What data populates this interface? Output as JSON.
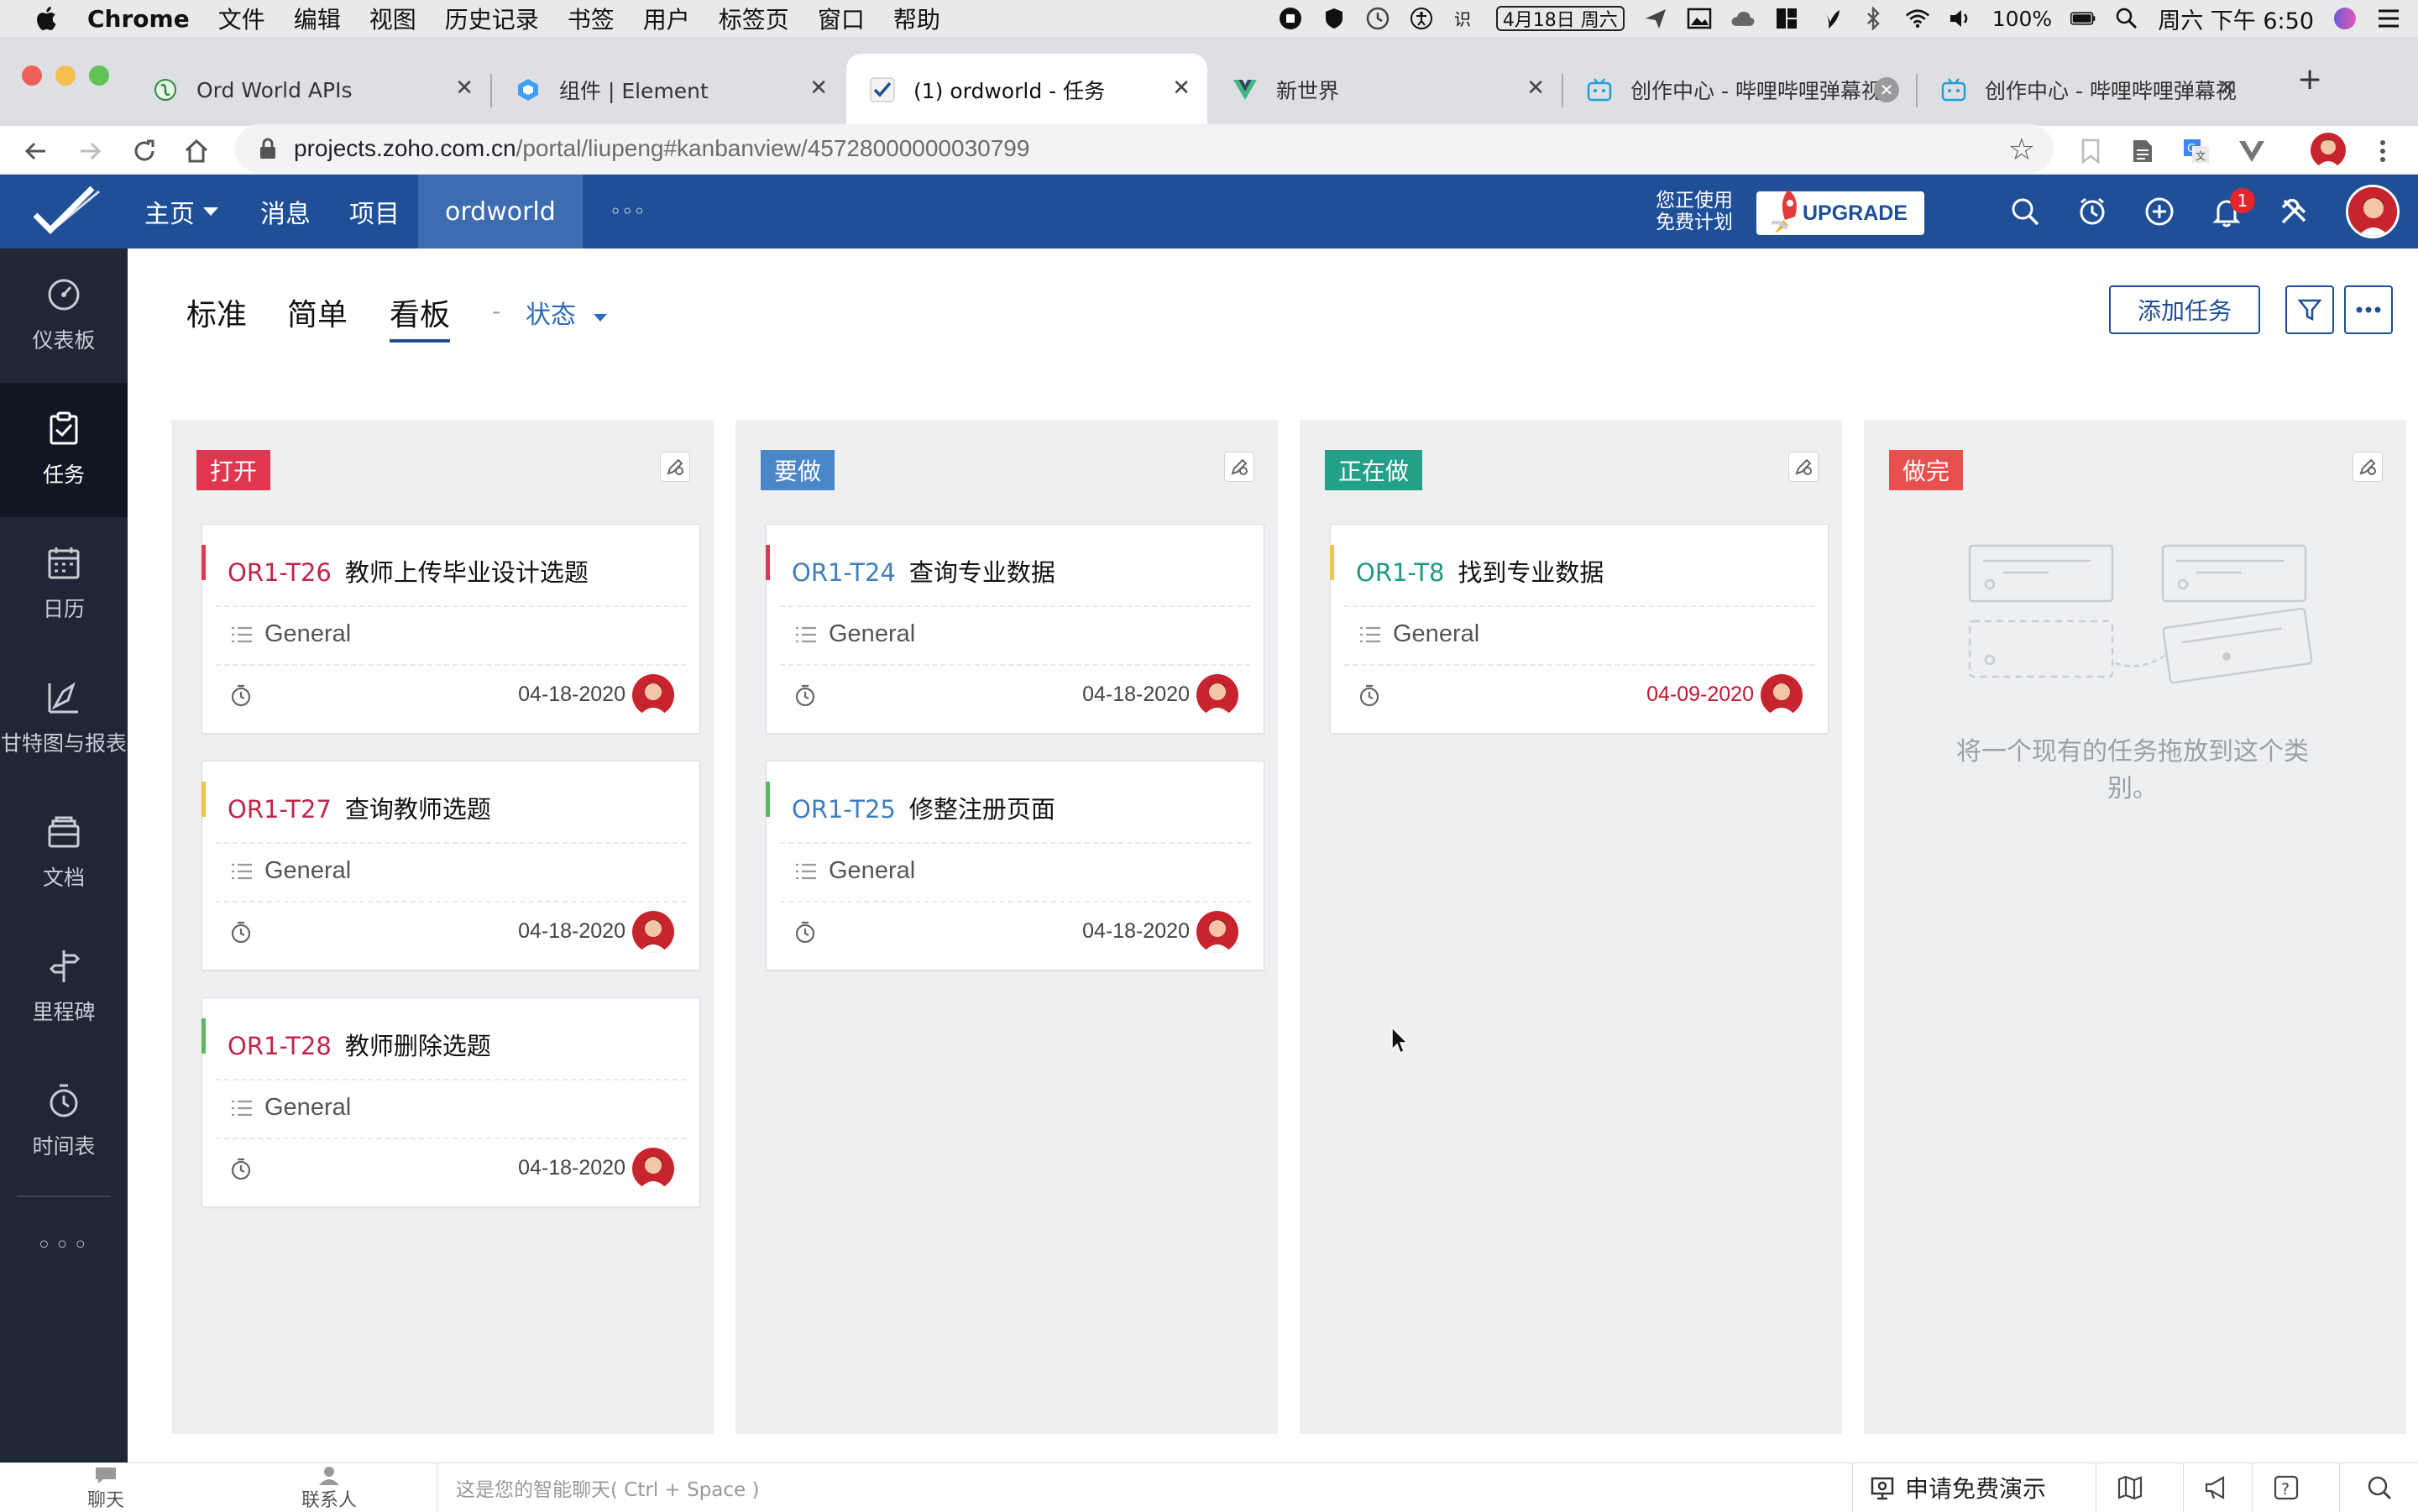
{
  "menubar": {
    "app_name": "Chrome",
    "items": [
      "文件",
      "编辑",
      "视图",
      "历史记录",
      "书签",
      "用户",
      "标签页",
      "窗口",
      "帮助"
    ],
    "date_badge": "4月18日 周六",
    "battery": "100%",
    "clock": "周六 下午 6:50"
  },
  "tabs": [
    {
      "title": "Ord World APIs"
    },
    {
      "title": "组件 | Element"
    },
    {
      "title": "(1) ordworld - 任务"
    },
    {
      "title": "新世界"
    },
    {
      "title": "创作中心 - 哔哩哔哩弹幕视"
    },
    {
      "title": "创作中心 - 哔哩哔哩弹幕视"
    }
  ],
  "browser": {
    "url_host": "projects.zoho.com.cn",
    "url_path": "/portal/liupeng#kanbanview/45728000000030799"
  },
  "header": {
    "nav": [
      "主页",
      "消息",
      "项目",
      "ordworld",
      "◦◦◦"
    ],
    "plan_line1": "您正使用",
    "plan_line2": "免费计划",
    "upgrade": "UPGRADE",
    "notif_count": "1"
  },
  "sidebar": {
    "items": [
      {
        "label": "仪表板",
        "icon": "dashboard-icon"
      },
      {
        "label": "任务",
        "icon": "task-icon"
      },
      {
        "label": "日历",
        "icon": "calendar-icon"
      },
      {
        "label": "甘特图与报表",
        "icon": "gantt-icon"
      },
      {
        "label": "文档",
        "icon": "document-icon"
      },
      {
        "label": "里程碑",
        "icon": "milestone-icon"
      },
      {
        "label": "时间表",
        "icon": "timesheet-icon"
      }
    ],
    "more": "◦◦◦"
  },
  "views": {
    "tabs": [
      "标准",
      "简单",
      "看板"
    ],
    "dash": "-",
    "group_by": "状态",
    "add_task": "添加任务"
  },
  "columns": [
    {
      "label": "打开",
      "color": "#e0364f",
      "cards": [
        {
          "id": "OR1-T26",
          "title": "教师上传毕业设计选题",
          "list": "General",
          "date": "04-18-2020",
          "prio_color": "#e0364f",
          "id_color": "#c0254a",
          "overdue": false
        },
        {
          "id": "OR1-T27",
          "title": "查询教师选题",
          "list": "General",
          "date": "04-18-2020",
          "prio_color": "#f3c34d",
          "id_color": "#c0254a",
          "overdue": false
        },
        {
          "id": "OR1-T28",
          "title": "教师删除选题",
          "list": "General",
          "date": "04-18-2020",
          "prio_color": "#5cb85c",
          "id_color": "#c0254a",
          "overdue": false
        }
      ]
    },
    {
      "label": "要做",
      "color": "#4a86c8",
      "cards": [
        {
          "id": "OR1-T24",
          "title": "查询专业数据",
          "list": "General",
          "date": "04-18-2020",
          "prio_color": "#e0364f",
          "id_color": "#3f7fbf",
          "overdue": false
        },
        {
          "id": "OR1-T25",
          "title": "修整注册页面",
          "list": "General",
          "date": "04-18-2020",
          "prio_color": "#5cb85c",
          "id_color": "#3f7fbf",
          "overdue": false
        }
      ]
    },
    {
      "label": "正在做",
      "color": "#24a089",
      "cards": [
        {
          "id": "OR1-T8",
          "title": "找到专业数据",
          "list": "General",
          "date": "04-09-2020",
          "prio_color": "#f3c34d",
          "id_color": "#1f9a80",
          "overdue": true
        }
      ]
    },
    {
      "label": "做完",
      "color": "#ea4f4f",
      "cards": [],
      "empty_text": "将一个现有的任务拖放到这个类别。"
    }
  ],
  "bottombar": {
    "chat": "聊天",
    "contacts": "联系人",
    "chat_placeholder": "这是您的智能聊天( Ctrl + Space )",
    "demo": "申请免费演示"
  }
}
